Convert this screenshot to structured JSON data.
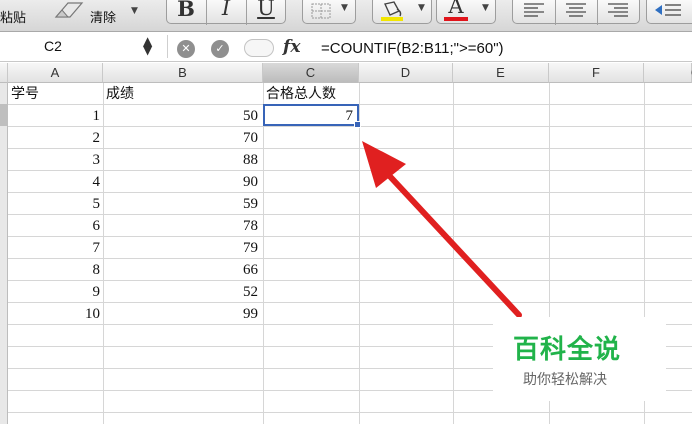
{
  "toolbar": {
    "paste_label": "粘贴",
    "clear_label": "清除",
    "bold_label": "B",
    "italic_label": "I",
    "underline_label": "U",
    "font_color_label": "A",
    "highlight_color": "#f2e600",
    "font_color": "#e0141b"
  },
  "formula_bar": {
    "cell_ref": "C2",
    "fx_label": "fx",
    "formula": "=COUNTIF(B2:B11;\">=60\")"
  },
  "sheet": {
    "columns": [
      "A",
      "B",
      "C",
      "D",
      "E",
      "F",
      "G"
    ],
    "selected_column": "C",
    "selected_cell": "C2",
    "headers": [
      "学号",
      "成绩",
      "合格总人数"
    ],
    "rows": [
      {
        "id": "1",
        "score": "50",
        "result": "7"
      },
      {
        "id": "2",
        "score": "70",
        "result": ""
      },
      {
        "id": "3",
        "score": "88",
        "result": ""
      },
      {
        "id": "4",
        "score": "90",
        "result": ""
      },
      {
        "id": "5",
        "score": "59",
        "result": ""
      },
      {
        "id": "6",
        "score": "78",
        "result": ""
      },
      {
        "id": "7",
        "score": "79",
        "result": ""
      },
      {
        "id": "8",
        "score": "66",
        "result": ""
      },
      {
        "id": "9",
        "score": "52",
        "result": ""
      },
      {
        "id": "10",
        "score": "99",
        "result": ""
      }
    ]
  },
  "annotation": {
    "arrow_color": "#e02020"
  },
  "watermark": {
    "title": "百科全说",
    "subtitle": "助你轻松解决"
  }
}
